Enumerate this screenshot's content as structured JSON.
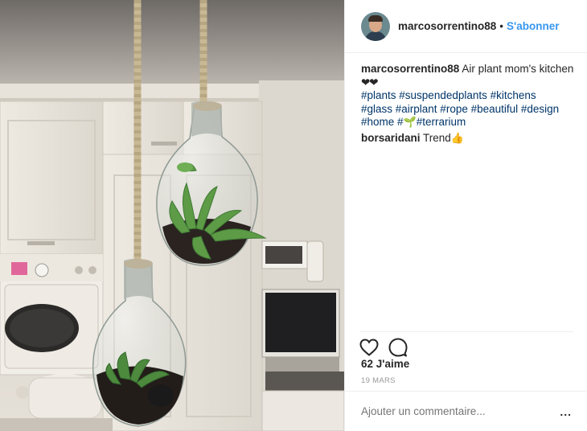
{
  "post": {
    "username": "marcosorrentino88",
    "separator": "•",
    "follow_label": "S'abonner",
    "caption": {
      "author": "marcosorrentino88",
      "text": "Air plant mom's kitchen",
      "emoji": "❤❤",
      "hashtags_line1": "#plants #suspendedplants #kitchens",
      "hashtags_line2": "#glass #airplant #rope #beautiful #design",
      "hashtags_line3a": "#home #",
      "sprout_icon": "🌱",
      "hashtags_line3b": "#terrarium"
    },
    "comments": [
      {
        "author": "borsaridani",
        "text": "Trend",
        "emoji": "👍"
      }
    ],
    "likes": "62 J'aime",
    "date": "19 MARS",
    "comment_placeholder": "Ajouter un commentaire...",
    "more_label": "..."
  },
  "icons": {
    "like": "heart-outline-icon",
    "comment": "speech-bubble-icon",
    "more": "ellipsis-icon"
  },
  "colors": {
    "link_blue": "#3897f0",
    "hashtag": "#003569",
    "muted": "#999999"
  }
}
